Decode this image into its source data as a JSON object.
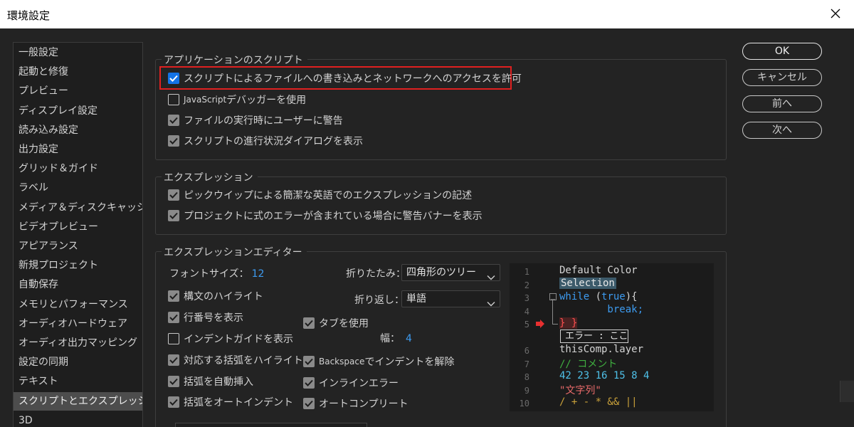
{
  "window": {
    "title": "環境設定",
    "close_icon": "close-icon"
  },
  "sidebar": {
    "items": [
      "一般設定",
      "起動と修復",
      "プレビュー",
      "ディスプレイ設定",
      "読み込み設定",
      "出力設定",
      "グリッド＆ガイド",
      "ラベル",
      "メディア＆ディスクキャッシュ",
      "ビデオプレビュー",
      "アピアランス",
      "新規プロジェクト",
      "自動保存",
      "メモリとパフォーマンス",
      "オーディオハードウェア",
      "オーディオ出力マッピング",
      "設定の同期",
      "テキスト",
      "スクリプトとエクスプレッション",
      "3D"
    ],
    "selected_index": 18
  },
  "scripts_group": {
    "title": "アプリケーションのスクリプト",
    "opt1": {
      "label": "スクリプトによるファイルへの書き込みとネットワークへのアクセスを許可",
      "checked": true
    },
    "opt2": {
      "label_prefix": "JavaScript",
      "label_suffix": " デバッガーを使用",
      "checked": false
    },
    "opt3": {
      "label": "ファイルの実行時にユーザーに警告",
      "checked": true
    },
    "opt4": {
      "label": "スクリプトの進行状況ダイアログを表示",
      "checked": true
    }
  },
  "expression_group": {
    "title": "エクスプレッション",
    "opt1": {
      "label": "ピックウイップによる簡潔な英語でのエクスプレッションの記述",
      "checked": true
    },
    "opt2": {
      "label": "プロジェクトに式のエラーが含まれている場合に警告バナーを表示",
      "checked": true
    }
  },
  "editor_group": {
    "title": "エクスプレッションエディター",
    "font_size_label": "フォントサイズ：",
    "font_size_value": "12",
    "folding_label": "折りたたみ：",
    "folding_value": "四角形のツリー",
    "wrap_label": "折り返し：",
    "wrap_value": "単語",
    "tab_width_label": "幅：",
    "tab_width_value": "4",
    "syntax": {
      "label": "構文のハイライト",
      "checked": true
    },
    "line_numbers": {
      "label": "行番号を表示",
      "checked": true
    },
    "indent_guides": {
      "label": "インデントガイドを表示",
      "checked": false
    },
    "bracket_highlight": {
      "label": "対応する括弧をハイライト",
      "checked": true
    },
    "auto_bracket": {
      "label": "括弧を自動挿入",
      "checked": true
    },
    "auto_indent": {
      "label": "括弧をオートインデント",
      "checked": true
    },
    "use_tabs": {
      "label": "タブを使用",
      "checked": true
    },
    "backspace_unindent": {
      "label_prefix": "Backspace",
      "label_suffix": " でインデントを解除",
      "checked": true
    },
    "inline_errors": {
      "label": "インラインエラー",
      "checked": true
    },
    "autocomplete": {
      "label": "オートコンプリート",
      "checked": true
    }
  },
  "buttons": {
    "ok": "OK",
    "cancel": "キャンセル",
    "prev": "前へ",
    "next": "次へ"
  },
  "code_preview": {
    "line_numbers": [
      "1",
      "2",
      "3",
      "4",
      "5",
      "6",
      "7",
      "8",
      "9",
      "10"
    ],
    "line1": "Default Color",
    "line2": "Selection",
    "line3_kw": "while",
    "line3_paren_open": " (",
    "line3_true": "true",
    "line3_rest": "){",
    "line4": "        break;",
    "line5": "} }",
    "error_tip": "エラー : ここ",
    "line6": "thisComp.layer",
    "line7": "// コメント",
    "line8": "42 23 16 15 8 4",
    "line9": "\"文字列\"",
    "line10": "/ + - * && ||"
  },
  "colors": {
    "accent": "#1473e6",
    "highlight_box": "#e02020",
    "keyword": "#3d9bf0",
    "error": "#ff5050"
  }
}
